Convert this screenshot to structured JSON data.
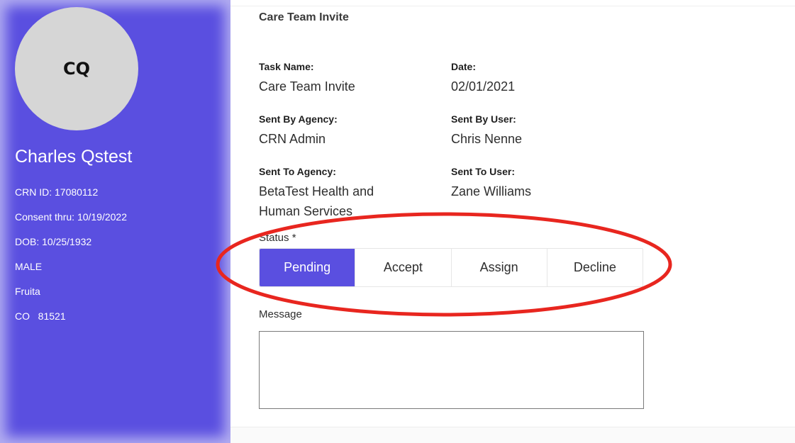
{
  "patient": {
    "initials": "CQ",
    "name": "Charles Qstest",
    "crn_id": "CRN ID: 17080112",
    "consent": "Consent thru: 10/19/2022",
    "dob": "DOB: 10/25/1932",
    "sex": "MALE",
    "city": "Fruita",
    "state_zip": "CO   81521"
  },
  "task": {
    "title": "Care Team Invite",
    "fields": {
      "task_name": {
        "label": "Task Name:",
        "value": "Care Team Invite"
      },
      "date": {
        "label": "Date:",
        "value": "02/01/2021"
      },
      "sent_by_agency": {
        "label": "Sent By Agency:",
        "value": "CRN Admin"
      },
      "sent_by_user": {
        "label": "Sent By User:",
        "value": "Chris Nenne"
      },
      "sent_to_agency": {
        "label": "Sent To Agency:",
        "value_line1": "BetaTest Health and",
        "value_line2": "Human Services"
      },
      "sent_to_user": {
        "label": "Sent To User:",
        "value": "Zane Williams"
      }
    },
    "status": {
      "label": "Status *",
      "options": [
        "Pending",
        "Accept",
        "Assign",
        "Decline"
      ],
      "selected": "Pending"
    },
    "message": {
      "label": "Message",
      "value": ""
    }
  },
  "colors": {
    "sidebar_bg": "#5a4fe0",
    "selected_status_bg": "#5a4fe0",
    "annotation_ellipse": "#e8261f"
  }
}
